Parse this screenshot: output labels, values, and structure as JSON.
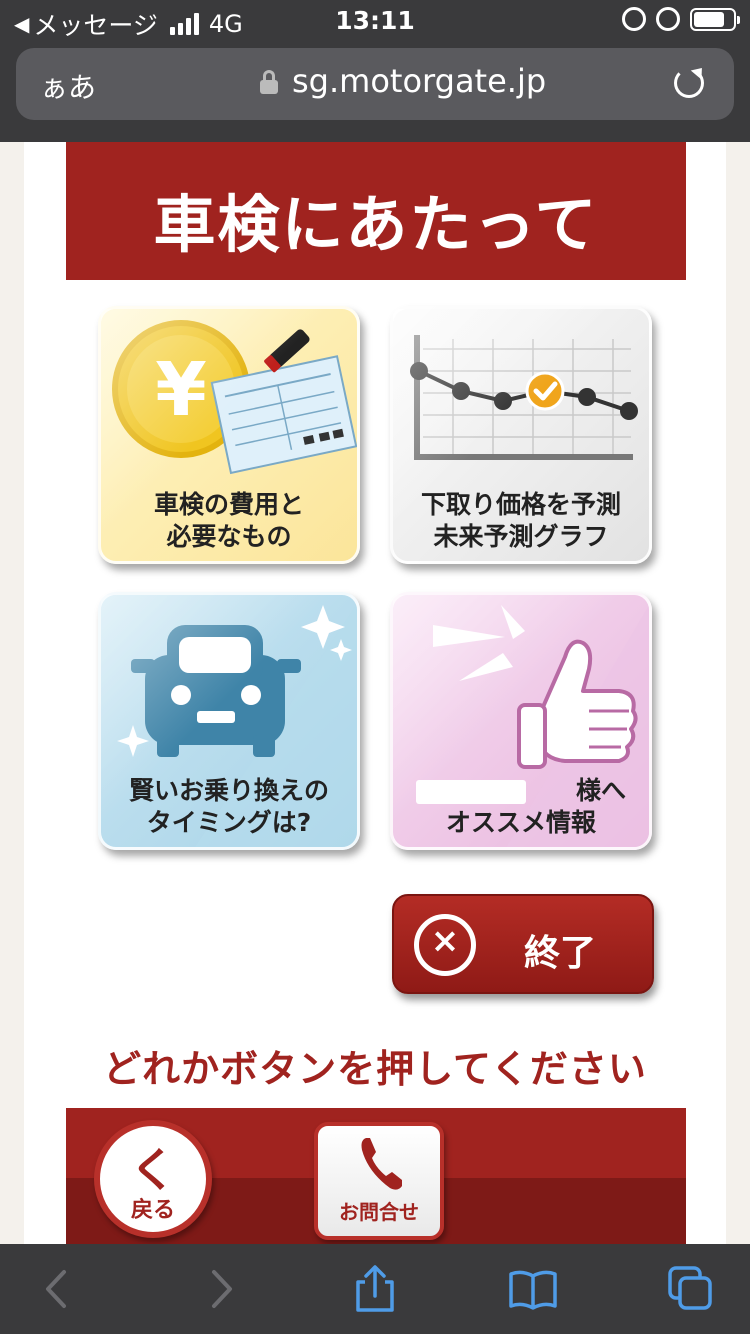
{
  "status_bar": {
    "back_app": "メッセージ",
    "network": "4G",
    "time": "13:11",
    "signal_bars": 4,
    "battery_level": 0.8
  },
  "address_bar": {
    "reader_label": "ぁあ",
    "url": "sg.motorgate.jp",
    "lock_icon": "lock-icon",
    "reload_icon": "reload-icon"
  },
  "header": {
    "title": "車検にあたって"
  },
  "menu": {
    "tiles": [
      {
        "line1": "車検の費用と",
        "line2": "必要なもの",
        "icon": "yen-document-icon",
        "color": "#fbe59a"
      },
      {
        "line1": "下取り価格を予測",
        "line2": "未来予測グラフ",
        "icon": "price-graph-icon",
        "color": "#e2e2e2"
      },
      {
        "line1": "賢いお乗り換えの",
        "line2": "タイミングは?",
        "icon": "car-icon",
        "color": "#a8d3e7"
      },
      {
        "line1_suffix": "様へ",
        "line2": "オススメ情報",
        "icon": "thumbs-up-icon",
        "color": "#e8b7dd"
      }
    ]
  },
  "end_button": {
    "label": "終了",
    "icon_glyph": "×"
  },
  "prompt": "どれかボタンを押してください",
  "footer": {
    "back_label": "戻る",
    "back_glyph": "く",
    "contact_label": "お問合せ"
  },
  "colors": {
    "brand_red": "#a0231f",
    "dark_red": "#7e1a17",
    "chrome_dark": "#3a3a3c",
    "toolbar_blue": "#4f9ce8"
  }
}
